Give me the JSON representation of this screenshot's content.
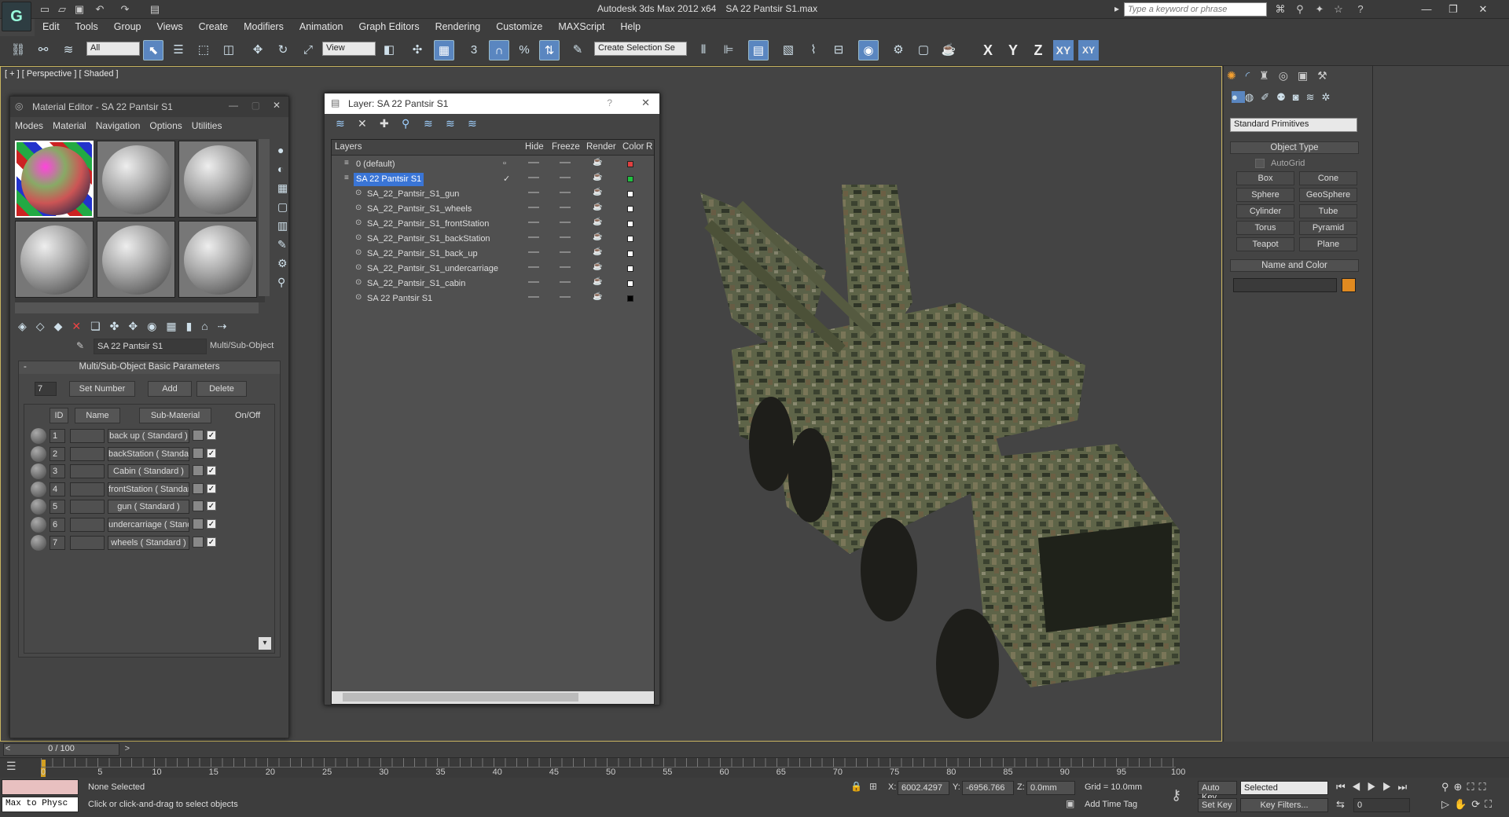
{
  "app": {
    "title": "Autodesk 3ds Max  2012 x64",
    "file": "SA 22 Pantsir S1.max",
    "search_placeholder": "Type a keyword or phrase"
  },
  "menu": [
    "Edit",
    "Tools",
    "Group",
    "Views",
    "Create",
    "Modifiers",
    "Animation",
    "Graph Editors",
    "Rendering",
    "Customize",
    "MAXScript",
    "Help"
  ],
  "toolbar": {
    "filter": "All",
    "ref_coord": "View",
    "selection_set": "Create Selection Se",
    "axes": [
      "X",
      "Y",
      "Z",
      "XY",
      "XY"
    ]
  },
  "viewport": {
    "label": "[ + ] [ Perspective ] [ Shaded ]"
  },
  "material_editor": {
    "title": "Material Editor - SA 22 Pantsir S1",
    "menus": [
      "Modes",
      "Material",
      "Navigation",
      "Options",
      "Utilities"
    ],
    "material_name": "SA 22 Pantsir S1",
    "material_type": "Multi/Sub-Object",
    "rollout_title": "Multi/Sub-Object Basic Parameters",
    "count": "7",
    "set_number": "Set Number",
    "add": "Add",
    "delete": "Delete",
    "headers": {
      "id": "ID",
      "name": "Name",
      "sub": "Sub-Material",
      "onoff": "On/Off"
    },
    "rows": [
      {
        "id": "1",
        "sub": "back up  ( Standard )"
      },
      {
        "id": "2",
        "sub": "backStation  ( Standard )"
      },
      {
        "id": "3",
        "sub": "Cabin  ( Standard )"
      },
      {
        "id": "4",
        "sub": "frontStation  ( Standard )"
      },
      {
        "id": "5",
        "sub": "gun  ( Standard )"
      },
      {
        "id": "6",
        "sub": "undercarriage  ( Standard )"
      },
      {
        "id": "7",
        "sub": "wheels  ( Standard )"
      }
    ]
  },
  "layer_manager": {
    "title": "Layer: SA 22 Pantsir S1",
    "help": "?",
    "headers": {
      "layers": "Layers",
      "hide": "Hide",
      "freeze": "Freeze",
      "render": "Render",
      "color": "Color",
      "r": "R"
    },
    "rows": [
      {
        "name": "0 (default)",
        "color": "#e04040",
        "indent": 0
      },
      {
        "name": "SA 22 Pantsir S1",
        "color": "#20c040",
        "indent": 0,
        "selected": true
      },
      {
        "name": "SA_22_Pantsir_S1_gun",
        "color": "#ffffff",
        "indent": 1
      },
      {
        "name": "SA_22_Pantsir_S1_wheels",
        "color": "#ffffff",
        "indent": 1
      },
      {
        "name": "SA_22_Pantsir_S1_frontStation",
        "color": "#ffffff",
        "indent": 1
      },
      {
        "name": "SA_22_Pantsir_S1_backStation",
        "color": "#ffffff",
        "indent": 1
      },
      {
        "name": "SA_22_Pantsir_S1_back_up",
        "color": "#ffffff",
        "indent": 1
      },
      {
        "name": "SA_22_Pantsir_S1_undercarriage",
        "color": "#ffffff",
        "indent": 1
      },
      {
        "name": "SA_22_Pantsir_S1_cabin",
        "color": "#ffffff",
        "indent": 1
      },
      {
        "name": "SA 22 Pantsir S1",
        "color": "#000000",
        "indent": 1
      }
    ]
  },
  "command_panel": {
    "category": "Standard Primitives",
    "object_type": "Object Type",
    "autogrid": "AutoGrid",
    "buttons": [
      "Box",
      "Cone",
      "Sphere",
      "GeoSphere",
      "Cylinder",
      "Tube",
      "Torus",
      "Pyramid",
      "Teapot",
      "Plane"
    ],
    "name_and_color": "Name and Color",
    "swatch_color": "#e08a20"
  },
  "timeline": {
    "frame": "0 / 100",
    "ticks": [
      "0",
      "5",
      "10",
      "15",
      "20",
      "25",
      "30",
      "35",
      "40",
      "45",
      "50",
      "55",
      "60",
      "65",
      "70",
      "75",
      "80",
      "85",
      "90",
      "95",
      "100"
    ]
  },
  "status": {
    "script": "Max to Physc",
    "selected": "None Selected",
    "prompt": "Click or click-and-drag to select objects",
    "x": "6002.4297",
    "y": "-6956.766",
    "z": "0.0mm",
    "grid": "Grid = 10.0mm",
    "add_time_tag": "Add Time Tag",
    "auto_key": "Auto Key",
    "set_key": "Set Key",
    "key_mode": "Selected",
    "key_filters": "Key Filters...",
    "current_frame": "0"
  }
}
